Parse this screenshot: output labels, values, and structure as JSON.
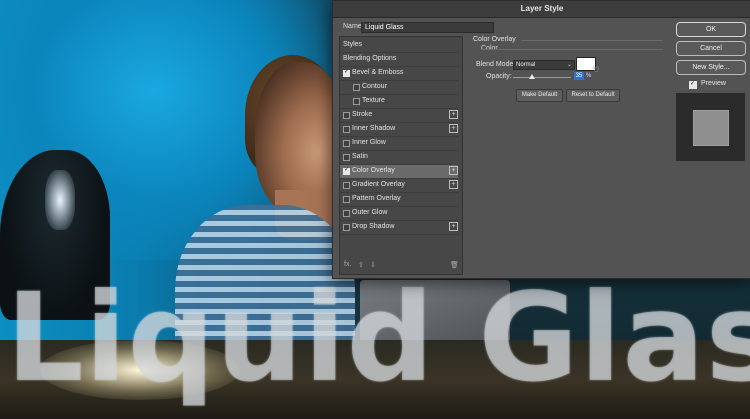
{
  "overlay_text": "Liquid Glass",
  "dialog": {
    "title": "Layer Style",
    "name_label": "Name:",
    "name_value": "Liquid Glass",
    "styles_panel": {
      "items": [
        {
          "label": "Styles",
          "checkbox": false,
          "checked": false,
          "plus": false,
          "indent": 0
        },
        {
          "label": "Blending Options",
          "checkbox": false,
          "checked": false,
          "plus": false,
          "indent": 0
        },
        {
          "label": "Bevel & Emboss",
          "checkbox": true,
          "checked": true,
          "plus": false,
          "indent": 0
        },
        {
          "label": "Contour",
          "checkbox": true,
          "checked": false,
          "plus": false,
          "indent": 1
        },
        {
          "label": "Texture",
          "checkbox": true,
          "checked": false,
          "plus": false,
          "indent": 1
        },
        {
          "label": "Stroke",
          "checkbox": true,
          "checked": false,
          "plus": true,
          "indent": 0
        },
        {
          "label": "Inner Shadow",
          "checkbox": true,
          "checked": false,
          "plus": true,
          "indent": 0
        },
        {
          "label": "Inner Glow",
          "checkbox": true,
          "checked": false,
          "plus": false,
          "indent": 0
        },
        {
          "label": "Satin",
          "checkbox": true,
          "checked": false,
          "plus": false,
          "indent": 0
        },
        {
          "label": "Color Overlay",
          "checkbox": true,
          "checked": true,
          "plus": true,
          "indent": 0,
          "selected": true
        },
        {
          "label": "Gradient Overlay",
          "checkbox": true,
          "checked": false,
          "plus": true,
          "indent": 0
        },
        {
          "label": "Pattern Overlay",
          "checkbox": true,
          "checked": false,
          "plus": false,
          "indent": 0
        },
        {
          "label": "Outer Glow",
          "checkbox": true,
          "checked": false,
          "plus": false,
          "indent": 0
        },
        {
          "label": "Drop Shadow",
          "checkbox": true,
          "checked": false,
          "plus": true,
          "indent": 0
        }
      ],
      "bottom_icons": [
        "fx-icon",
        "arrow-up-icon",
        "arrow-down-icon",
        "trash-icon"
      ],
      "fx_label": "fx."
    },
    "color_overlay": {
      "group_title": "Color Overlay",
      "sub_title": "Color",
      "blend_mode_label": "Blend Mode:",
      "blend_mode_value": "Normal",
      "overlay_color": "#ffffff",
      "opacity_label": "Opacity:",
      "opacity_value": "35",
      "opacity_unit": "%",
      "make_default": "Make Default",
      "reset_default": "Reset to Default"
    },
    "buttons": {
      "ok": "OK",
      "cancel": "Cancel",
      "new_style": "New Style...",
      "preview_label": "Preview",
      "preview_checked": true
    }
  }
}
